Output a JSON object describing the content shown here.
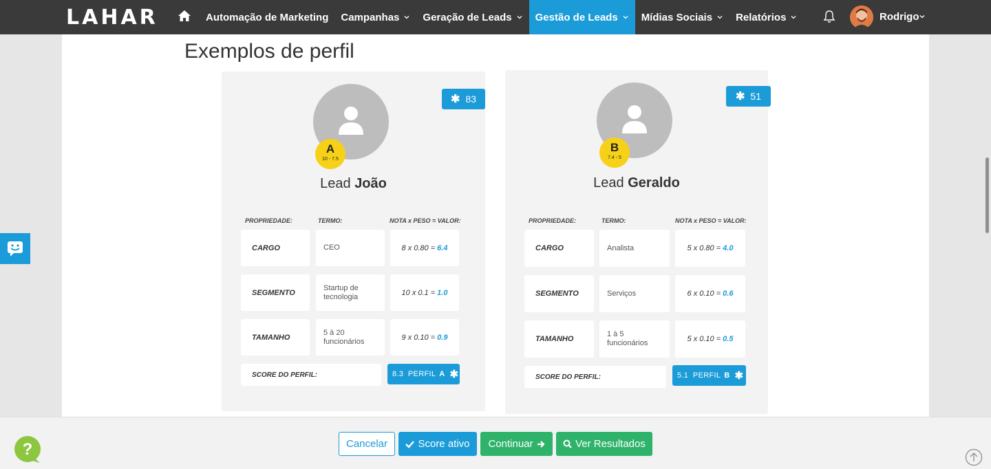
{
  "app": {
    "logo_text": "LAHAR"
  },
  "nav": {
    "items": [
      {
        "label": "Automação de Marketing",
        "has_dropdown": false,
        "active": false
      },
      {
        "label": "Campanhas",
        "has_dropdown": true,
        "active": false
      },
      {
        "label": "Geração de Leads",
        "has_dropdown": true,
        "active": false
      },
      {
        "label": "Gestão de Leads",
        "has_dropdown": true,
        "active": true
      },
      {
        "label": "Mídias Sociais",
        "has_dropdown": true,
        "active": false
      },
      {
        "label": "Relatórios",
        "has_dropdown": true,
        "active": false
      }
    ],
    "user_name": "Rodrigo"
  },
  "page": {
    "title": "Exemplos de perfil"
  },
  "cards": [
    {
      "score": "83",
      "grade": "A",
      "grade_range": "10 - 7.5",
      "lead_prefix": "Lead",
      "lead_name": "João",
      "headers": {
        "property": "PROPRIEDADE:",
        "term": "TERMO:",
        "calc": "NOTA x PESO = VALOR:"
      },
      "rows": [
        {
          "property": "CARGO",
          "term": "CEO",
          "calc": "8 x 0.80 =",
          "value": "6.4"
        },
        {
          "property": "SEGMENTO",
          "term": "Startup de tecnologia",
          "calc": "10 x 0.1 =",
          "value": "1.0"
        },
        {
          "property": "TAMANHO",
          "term": "5 à 20 funcionários",
          "calc": "9 x 0.10 =",
          "value": "0.9"
        }
      ],
      "score_label": "SCORE DO PERFIL:",
      "profile_score": "8.3",
      "profile_word": "PERFIL",
      "profile_grade": "A"
    },
    {
      "score": "51",
      "grade": "B",
      "grade_range": "7.4 - 5",
      "lead_prefix": "Lead",
      "lead_name": "Geraldo",
      "headers": {
        "property": "PROPRIEDADE:",
        "term": "TERMO:",
        "calc": "NOTA x PESO = VALOR:"
      },
      "rows": [
        {
          "property": "CARGO",
          "term": "Analista",
          "calc": "5 x 0.80 =",
          "value": "4.0"
        },
        {
          "property": "SEGMENTO",
          "term": "Serviços",
          "calc": "6 x 0.10 =",
          "value": "0.6"
        },
        {
          "property": "TAMANHO",
          "term": "1 à 5 funcionários",
          "calc": "5 x 0.10 =",
          "value": "0.5"
        }
      ],
      "score_label": "SCORE DO PERFIL:",
      "profile_score": "5.1",
      "profile_word": "PERFIL",
      "profile_grade": "B"
    }
  ],
  "footer": {
    "cancel_label": "Cancelar",
    "score_label": "Score ativo",
    "continue_label": "Continuar",
    "results_label": "Ver Resultados"
  },
  "colors": {
    "primary": "#1b9bd8",
    "success": "#2fb36b",
    "topbar": "#3a3a3a",
    "grade": "#f7d117"
  }
}
